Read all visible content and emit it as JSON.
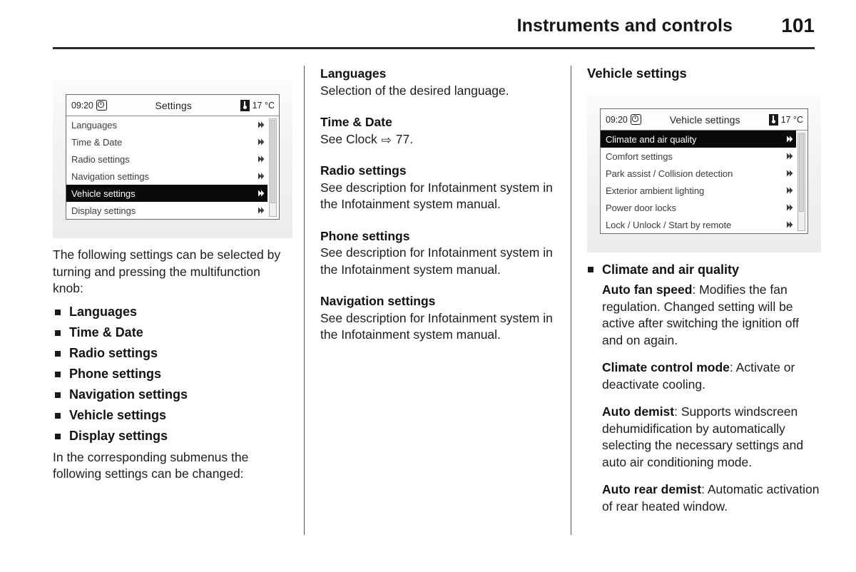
{
  "header": {
    "title": "Instruments and controls",
    "page_number": "101"
  },
  "column_left": {
    "display": {
      "clock": "09:20",
      "title": "Settings",
      "temperature": "17 °C",
      "clock_icon": "clock-icon",
      "temperature_icon": "thermometer-icon",
      "rows": [
        {
          "label": "Languages",
          "selected": false
        },
        {
          "label": "Time & Date",
          "selected": false
        },
        {
          "label": "Radio settings",
          "selected": false
        },
        {
          "label": "Navigation settings",
          "selected": false
        },
        {
          "label": "Vehicle settings",
          "selected": true
        },
        {
          "label": "Display settings",
          "selected": false
        }
      ],
      "scroll_thumb_pct": 86
    },
    "intro_text": "The following settings can be selected by turning and pressing the multifunction knob:",
    "bullets": [
      "Languages",
      "Time & Date",
      "Radio settings",
      "Phone settings",
      "Navigation settings",
      "Vehicle settings",
      "Display settings"
    ],
    "closing_text": "In the corresponding submenus the following settings can be changed:"
  },
  "column_middle": {
    "sections": [
      {
        "heading": "Languages",
        "body": "Selection of the desired language."
      },
      {
        "heading": "Time & Date",
        "body_prefix": "See Clock ",
        "ref_arrow": "⇨",
        "body_suffix": " 77."
      },
      {
        "heading": "Radio settings",
        "body": "See description for Infotainment system in the Infotainment system manual."
      },
      {
        "heading": "Phone settings",
        "body": "See description for Infotainment system in the Infotainment system manual."
      },
      {
        "heading": "Navigation settings",
        "body": "See description for Infotainment system in the Infotainment system manual."
      }
    ]
  },
  "column_right": {
    "heading": "Vehicle settings",
    "display": {
      "clock": "09:20",
      "title": "Vehicle settings",
      "temperature": "17 °C",
      "clock_icon": "clock-icon",
      "temperature_icon": "thermometer-icon",
      "rows": [
        {
          "label": "Climate and air quality",
          "selected": true
        },
        {
          "label": "Comfort settings",
          "selected": false
        },
        {
          "label": "Park assist / Collision detection",
          "selected": false
        },
        {
          "label": "Exterior ambient lighting",
          "selected": false
        },
        {
          "label": "Power door locks",
          "selected": false
        },
        {
          "label": "Lock / Unlock / Start by remote",
          "selected": false
        }
      ],
      "scroll_thumb_pct": 80
    },
    "bullet_heading": "Climate and air quality",
    "entries": [
      {
        "term": "Auto fan speed",
        "separator": ": ",
        "description": "Modifies the fan regulation. Changed setting will be active after switching the ignition off and on again."
      },
      {
        "term": "Climate control mode",
        "separator": ": ",
        "description": "Activate or deactivate cooling."
      },
      {
        "term": "Auto demist",
        "separator": ": ",
        "description": "Supports windscreen dehumidification by automatically selecting the necessary settings and auto air conditioning mode."
      },
      {
        "term": "Auto rear demist",
        "separator": ": ",
        "description": "Automatic activation of rear heated window."
      }
    ]
  },
  "colors": {
    "text": "#1d1d1d",
    "rule": "#2a2a2a",
    "display_bezel": "#6b6b6b",
    "selected_row_bg": "#0a0a0a",
    "display_surround": "#f2f2f2"
  }
}
